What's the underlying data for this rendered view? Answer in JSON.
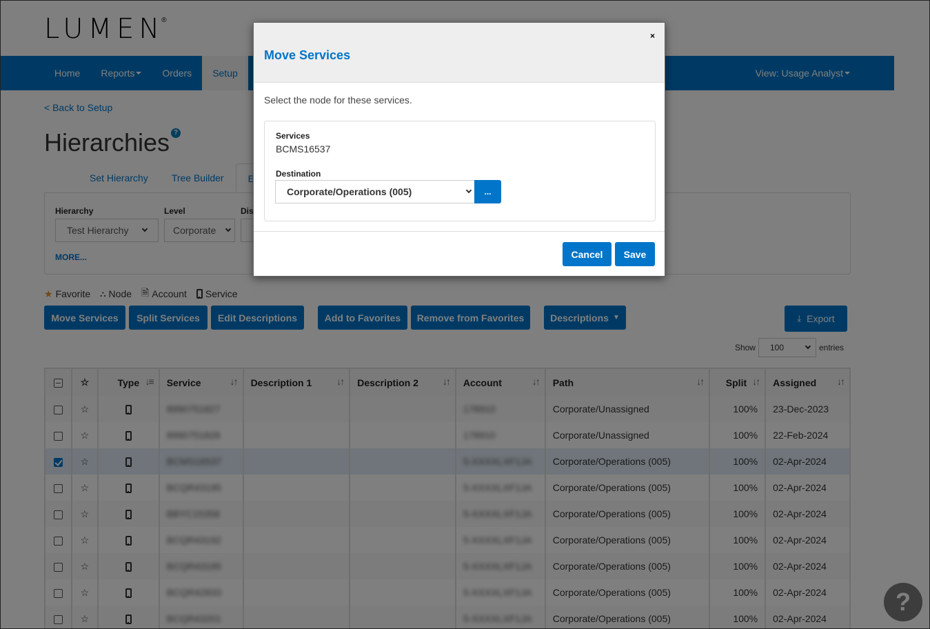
{
  "brand": {
    "logo_text": "LUMEN",
    "registered_mark": "®"
  },
  "colors": {
    "primary": "#0075c9",
    "accent_logo": "#38c6f4",
    "selected_row": "#dfeaf5"
  },
  "nav": {
    "items": [
      {
        "label": "Home",
        "has_dropdown": false,
        "active": false
      },
      {
        "label": "Reports",
        "has_dropdown": true,
        "active": false
      },
      {
        "label": "Orders",
        "has_dropdown": false,
        "active": false
      },
      {
        "label": "Setup",
        "has_dropdown": false,
        "active": true
      }
    ],
    "view_label": "View: Usage Analyst"
  },
  "page": {
    "back_link": "< Back to Setup",
    "title": "Hierarchies",
    "help_icon": "?",
    "tabs": [
      {
        "label": "Set Hierarchy",
        "active": false
      },
      {
        "label": "Tree Builder",
        "active": false
      },
      {
        "label": "E",
        "active": true
      }
    ],
    "filters": {
      "hierarchy_label": "Hierarchy",
      "hierarchy_value": "Test Hierarchy",
      "level_label": "Level",
      "level_value": "Corporate",
      "third_label": "Dis",
      "more_link": "MORE..."
    },
    "legend": [
      {
        "icon": "star-icon",
        "label": "Favorite"
      },
      {
        "icon": "node-icon",
        "label": "Node"
      },
      {
        "icon": "account-icon",
        "label": "Account"
      },
      {
        "icon": "phone-icon",
        "label": "Service"
      }
    ],
    "actions": {
      "move_services": "Move Services",
      "split_services": "Split Services",
      "edit_descriptions": "Edit Descriptions",
      "add_favorites": "Add to Favorites",
      "remove_favorites": "Remove from Favorites",
      "descriptions": "Descriptions",
      "export": "Export"
    },
    "entries": {
      "show_label": "Show",
      "value": "100",
      "entries_label": "entries"
    }
  },
  "table": {
    "columns": [
      "",
      "",
      "Type",
      "Service",
      "Description 1",
      "Description 2",
      "Account",
      "Path",
      "Split",
      "Assigned"
    ],
    "rows": [
      {
        "checked": false,
        "service": "8990751827",
        "desc1": "",
        "desc2": "",
        "account": "178910",
        "path": "Corporate/Unassigned",
        "split": "100%",
        "assigned": "23-Dec-2023"
      },
      {
        "checked": false,
        "service": "8990751828",
        "desc1": "",
        "desc2": "",
        "account": "178910",
        "path": "Corporate/Unassigned",
        "split": "100%",
        "assigned": "22-Feb-2024"
      },
      {
        "checked": true,
        "service": "BCMS16537",
        "desc1": "",
        "desc2": "",
        "account": "5-XXXXLXF1JA",
        "path": "Corporate/Operations (005)",
        "split": "100%",
        "assigned": "02-Apr-2024"
      },
      {
        "checked": false,
        "service": "BCQR43195",
        "desc1": "",
        "desc2": "",
        "account": "5-XXXXLXF1JA",
        "path": "Corporate/Operations (005)",
        "split": "100%",
        "assigned": "02-Apr-2024"
      },
      {
        "checked": false,
        "service": "BBYC15358",
        "desc1": "",
        "desc2": "",
        "account": "5-XXXXLXF1JA",
        "path": "Corporate/Operations (005)",
        "split": "100%",
        "assigned": "02-Apr-2024"
      },
      {
        "checked": false,
        "service": "BCQR43192",
        "desc1": "",
        "desc2": "",
        "account": "5-XXXXLXF1JA",
        "path": "Corporate/Operations (005)",
        "split": "100%",
        "assigned": "02-Apr-2024"
      },
      {
        "checked": false,
        "service": "BCQR43195",
        "desc1": "",
        "desc2": "",
        "account": "5-XXXXLXF1JA",
        "path": "Corporate/Operations (005)",
        "split": "100%",
        "assigned": "02-Apr-2024"
      },
      {
        "checked": false,
        "service": "BCQR42833",
        "desc1": "",
        "desc2": "",
        "account": "5-XXXXLXF1JA",
        "path": "Corporate/Operations (005)",
        "split": "100%",
        "assigned": "02-Apr-2024"
      },
      {
        "checked": false,
        "service": "BCQR43201",
        "desc1": "",
        "desc2": "",
        "account": "5-XXXXLXF1JA",
        "path": "Corporate/Operations (005)",
        "split": "100%",
        "assigned": "02-Apr-2024"
      }
    ]
  },
  "help_fab": "?",
  "modal": {
    "title": "Move Services",
    "close": "×",
    "intro": "Select the node for these services.",
    "services_label": "Services",
    "services_value": "BCMS16537",
    "destination_label": "Destination",
    "destination_value": "Corporate/Operations (005)",
    "browse_label": "...",
    "cancel": "Cancel",
    "save": "Save"
  }
}
